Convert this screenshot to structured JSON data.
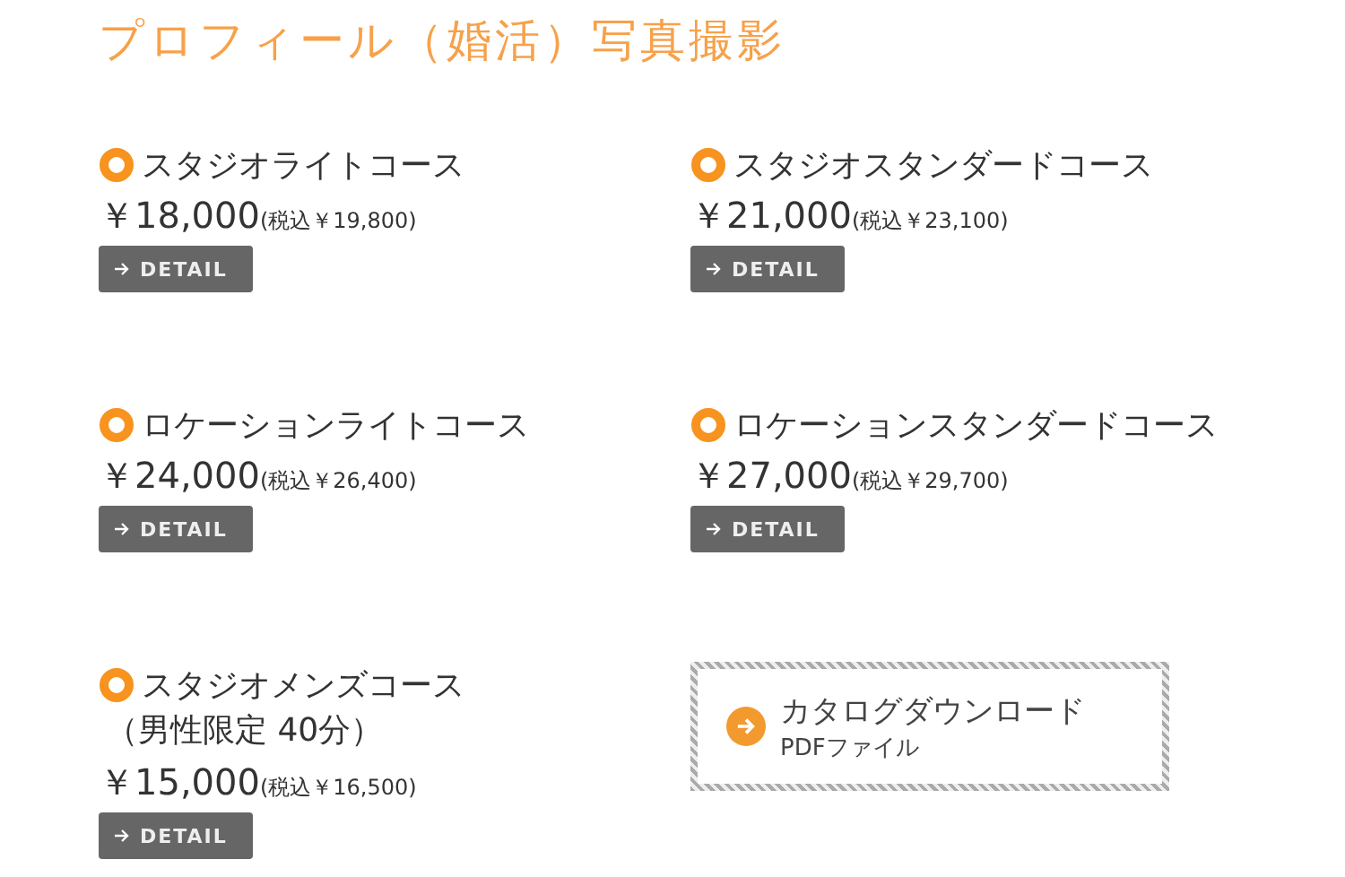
{
  "title": "プロフィール（婚活）写真撮影",
  "courses": [
    {
      "name": "スタジオライトコース",
      "price": "￥18,000",
      "tax_price": "(税込￥19,800)",
      "button": "DETAIL"
    },
    {
      "name": "スタジオスタンダードコース",
      "price": "￥21,000",
      "tax_price": "(税込￥23,100)",
      "button": "DETAIL"
    },
    {
      "name": "ロケーションライトコース",
      "price": "￥24,000",
      "tax_price": "(税込￥26,400)",
      "button": "DETAIL"
    },
    {
      "name": "ロケーションスタンダードコース",
      "price": "￥27,000",
      "tax_price": "(税込￥29,700)",
      "button": "DETAIL"
    },
    {
      "name": "スタジオメンズコース",
      "subtitle": "（男性限定 40分）",
      "price": "￥15,000",
      "tax_price": "(税込￥16,500)",
      "button": "DETAIL"
    }
  ],
  "catalog": {
    "label": "カタログダウンロード",
    "sublabel": "PDFファイル"
  }
}
